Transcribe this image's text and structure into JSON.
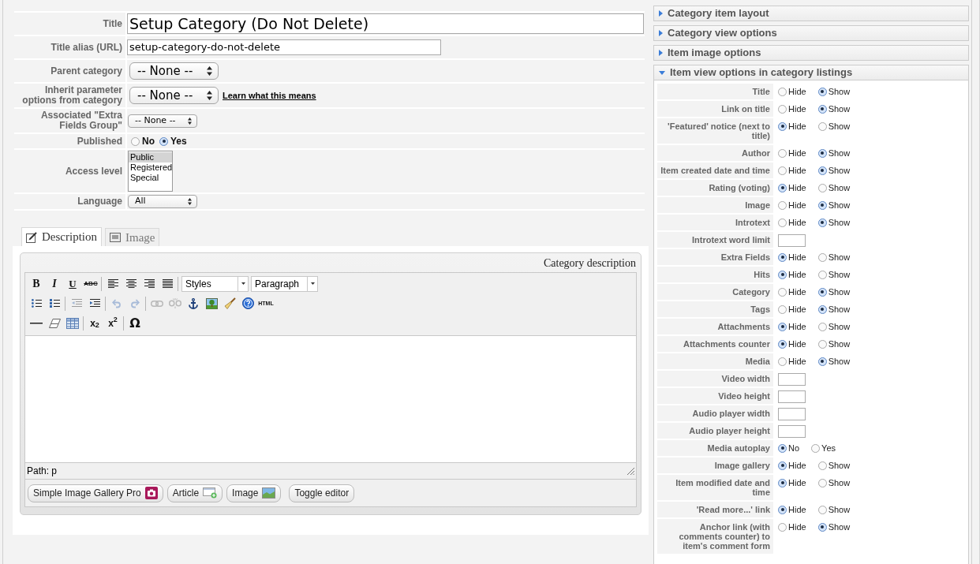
{
  "form": {
    "rows": [
      {
        "kind": "title",
        "label": "Title",
        "value": "Setup Category (Do Not Delete)"
      },
      {
        "kind": "input",
        "label": "Title alias (URL)",
        "value": "setup-category-do-not-delete"
      },
      {
        "kind": "select",
        "label": "Parent category",
        "value": "-- None --"
      },
      {
        "kind": "select",
        "label": "Inherit parameter options from category",
        "value": "-- None --",
        "link": "Learn what this means"
      },
      {
        "kind": "miniselect",
        "label": "Associated \"Extra Fields Group\"",
        "value": "-- None --"
      },
      {
        "kind": "radio",
        "label": "Published",
        "options": [
          {
            "label": "No",
            "selected": false
          },
          {
            "label": "Yes",
            "selected": true
          }
        ]
      },
      {
        "kind": "listbox",
        "label": "Access level",
        "options": [
          {
            "label": "Public",
            "selected": true
          },
          {
            "label": "Registered",
            "selected": false
          },
          {
            "label": "Special",
            "selected": false
          }
        ]
      },
      {
        "kind": "miniselect",
        "label": "Language",
        "value": "All"
      }
    ]
  },
  "tabs": [
    {
      "kind": "edit",
      "label": "Description",
      "selected": true
    },
    {
      "kind": "image",
      "label": "Image",
      "selected": false
    }
  ],
  "editor": {
    "title": "Category description",
    "toolbar": [
      {
        "groups": [
          [
            {
              "kind": "bold",
              "label": "B",
              "disabled": false
            },
            {
              "kind": "italic",
              "label": "I",
              "disabled": false
            },
            {
              "kind": "underline",
              "label": "U",
              "disabled": false
            },
            {
              "kind": "strike",
              "label": "ABC",
              "disabled": false
            }
          ],
          [
            {
              "kind": "alignleft",
              "disabled": false
            },
            {
              "kind": "aligncenter",
              "disabled": false
            },
            {
              "kind": "alignright",
              "disabled": false
            },
            {
              "kind": "justify",
              "disabled": false
            }
          ]
        ],
        "selects": [
          "Styles",
          "Paragraph"
        ]
      },
      {
        "groups": [
          [
            {
              "kind": "bullets",
              "disabled": false
            },
            {
              "kind": "numbers",
              "disabled": false
            }
          ],
          [
            {
              "kind": "outdent",
              "disabled": true
            },
            {
              "kind": "indent",
              "disabled": false
            }
          ],
          [
            {
              "kind": "undo",
              "disabled": true
            },
            {
              "kind": "redo",
              "disabled": true
            }
          ],
          [
            {
              "kind": "link",
              "disabled": true
            },
            {
              "kind": "unlink",
              "disabled": true
            },
            {
              "kind": "anchor",
              "disabled": false
            },
            {
              "kind": "image",
              "disabled": false
            },
            {
              "kind": "cleanup",
              "disabled": false
            },
            {
              "kind": "help",
              "disabled": false
            },
            {
              "kind": "html",
              "label": "HTML",
              "disabled": false
            }
          ]
        ]
      },
      {
        "groups": [
          [
            {
              "kind": "rule",
              "disabled": false
            },
            {
              "kind": "eraser",
              "disabled": false
            },
            {
              "kind": "table",
              "disabled": false
            }
          ],
          [
            {
              "kind": "sub",
              "label": "x$_{2}$",
              "disabled": false
            },
            {
              "kind": "sup",
              "label": "x$^{2}$",
              "disabled": false
            }
          ],
          [
            {
              "kind": "charmap",
              "label": "Ω",
              "disabled": false
            }
          ]
        ]
      }
    ],
    "path": "Path: p",
    "buttons": [
      {
        "kind": "gallery",
        "label": "Simple Image Gallery Pro"
      },
      {
        "kind": "article",
        "label": "Article"
      },
      {
        "kind": "image",
        "label": "Image"
      },
      {
        "kind": "toggle",
        "label": "Toggle editor"
      }
    ]
  },
  "panel": {
    "sections": [
      {
        "title": "Category item layout",
        "expanded": false
      },
      {
        "title": "Category view options",
        "expanded": false
      },
      {
        "title": "Item image options",
        "expanded": false
      },
      {
        "title": "Item view options in category listings",
        "expanded": true,
        "rows": [
          {
            "kind": "radio",
            "label": "Title",
            "options": [
              {
                "label": "Hide",
                "selected": false
              },
              {
                "label": "Show",
                "selected": true
              }
            ]
          },
          {
            "kind": "radio",
            "label": "Link on title",
            "options": [
              {
                "label": "Hide",
                "selected": false
              },
              {
                "label": "Show",
                "selected": true
              }
            ]
          },
          {
            "kind": "radio",
            "label": "'Featured' notice (next to title)",
            "options": [
              {
                "label": "Hide",
                "selected": true
              },
              {
                "label": "Show",
                "selected": false
              }
            ]
          },
          {
            "kind": "radio",
            "label": "Author",
            "options": [
              {
                "label": "Hide",
                "selected": false
              },
              {
                "label": "Show",
                "selected": true
              }
            ]
          },
          {
            "kind": "radio",
            "label": "Item created date and time",
            "options": [
              {
                "label": "Hide",
                "selected": false
              },
              {
                "label": "Show",
                "selected": true
              }
            ]
          },
          {
            "kind": "radio",
            "label": "Rating (voting)",
            "options": [
              {
                "label": "Hide",
                "selected": true
              },
              {
                "label": "Show",
                "selected": false
              }
            ]
          },
          {
            "kind": "radio",
            "label": "Image",
            "options": [
              {
                "label": "Hide",
                "selected": false
              },
              {
                "label": "Show",
                "selected": true
              }
            ]
          },
          {
            "kind": "radio",
            "label": "Introtext",
            "options": [
              {
                "label": "Hide",
                "selected": false
              },
              {
                "label": "Show",
                "selected": true
              }
            ]
          },
          {
            "kind": "input",
            "label": "Introtext word limit"
          },
          {
            "kind": "radio",
            "label": "Extra Fields",
            "options": [
              {
                "label": "Hide",
                "selected": true
              },
              {
                "label": "Show",
                "selected": false
              }
            ]
          },
          {
            "kind": "radio",
            "label": "Hits",
            "options": [
              {
                "label": "Hide",
                "selected": true
              },
              {
                "label": "Show",
                "selected": false
              }
            ]
          },
          {
            "kind": "radio",
            "label": "Category",
            "options": [
              {
                "label": "Hide",
                "selected": false
              },
              {
                "label": "Show",
                "selected": true
              }
            ]
          },
          {
            "kind": "radio",
            "label": "Tags",
            "options": [
              {
                "label": "Hide",
                "selected": false
              },
              {
                "label": "Show",
                "selected": true
              }
            ]
          },
          {
            "kind": "radio",
            "label": "Attachments",
            "options": [
              {
                "label": "Hide",
                "selected": true
              },
              {
                "label": "Show",
                "selected": false
              }
            ]
          },
          {
            "kind": "radio",
            "label": "Attachments counter",
            "options": [
              {
                "label": "Hide",
                "selected": true
              },
              {
                "label": "Show",
                "selected": false
              }
            ]
          },
          {
            "kind": "radio",
            "label": "Media",
            "options": [
              {
                "label": "Hide",
                "selected": false
              },
              {
                "label": "Show",
                "selected": true
              }
            ]
          },
          {
            "kind": "input",
            "label": "Video width"
          },
          {
            "kind": "input",
            "label": "Video height"
          },
          {
            "kind": "input",
            "label": "Audio player width"
          },
          {
            "kind": "input",
            "label": "Audio player height"
          },
          {
            "kind": "radio",
            "label": "Media autoplay",
            "options": [
              {
                "label": "No",
                "selected": true
              },
              {
                "label": "Yes",
                "selected": false
              }
            ]
          },
          {
            "kind": "radio",
            "label": "Image gallery",
            "options": [
              {
                "label": "Hide",
                "selected": true
              },
              {
                "label": "Show",
                "selected": false
              }
            ]
          },
          {
            "kind": "radio",
            "label": "Item modified date and time",
            "options": [
              {
                "label": "Hide",
                "selected": true
              },
              {
                "label": "Show",
                "selected": false
              }
            ]
          },
          {
            "kind": "radio",
            "label": "'Read more...' link",
            "options": [
              {
                "label": "Hide",
                "selected": true
              },
              {
                "label": "Show",
                "selected": false
              }
            ]
          },
          {
            "kind": "radio",
            "label": "Anchor link (with comments counter) to item's comment form",
            "options": [
              {
                "label": "Hide",
                "selected": false
              },
              {
                "label": "Show",
                "selected": true
              }
            ]
          }
        ]
      }
    ]
  }
}
